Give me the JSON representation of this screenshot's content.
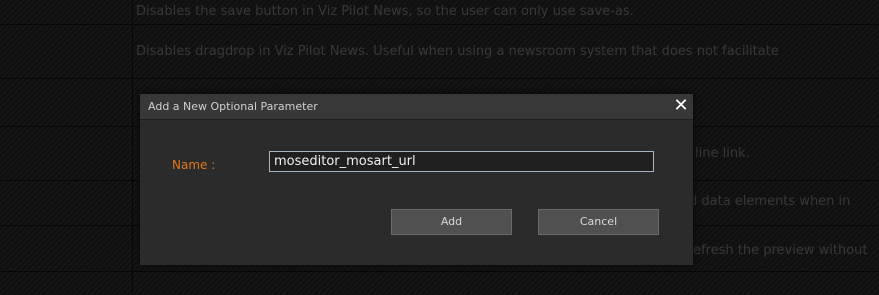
{
  "background_rows": [
    {
      "description": "Disables the save button in Viz Pilot News, so the user can only use save-as."
    },
    {
      "description": "Disables dragdrop in Viz Pilot News. Useful when using a newsroom system that does not facilitate"
    },
    {
      "description": ""
    },
    {
      "description": "line link."
    },
    {
      "description": "d data elements when in"
    },
    {
      "description": "efresh the preview without"
    },
    {
      "description": ""
    }
  ],
  "dialog": {
    "title": "Add a New Optional Parameter",
    "close_glyph": "✕",
    "name_label": "Name :",
    "name_value": "moseditor_mosart_url",
    "add_label": "Add",
    "cancel_label": "Cancel"
  },
  "colors": {
    "accent_label": "#e07820",
    "input_border": "#a8b4c0"
  }
}
